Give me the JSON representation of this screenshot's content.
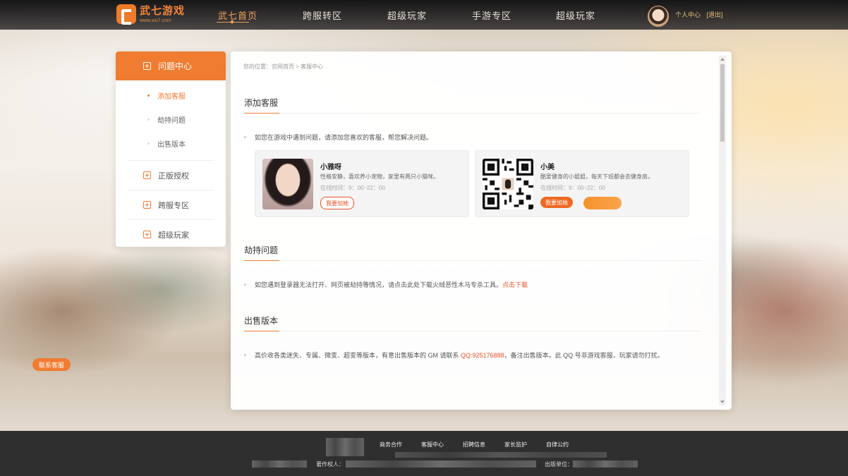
{
  "header": {
    "logo": {
      "name": "武七游戏",
      "url": "www.wu7.com"
    },
    "nav": [
      {
        "label": "武七首页",
        "active": true
      },
      {
        "label": "跨服转区",
        "active": false
      },
      {
        "label": "超级玩家",
        "active": false
      },
      {
        "label": "手游专区",
        "active": false
      },
      {
        "label": "超级玩家",
        "active": false
      }
    ],
    "user": {
      "center": "个人中心",
      "logout": "[退出]"
    }
  },
  "sidebar": {
    "head": "问题中心",
    "subitems": [
      {
        "label": "添加客服",
        "active": true
      },
      {
        "label": "劫持问题",
        "active": false
      },
      {
        "label": "出售版本",
        "active": false
      }
    ],
    "items": [
      {
        "label": "正版授权"
      },
      {
        "label": "跨服专区"
      },
      {
        "label": "超级玩家"
      }
    ]
  },
  "contact_button": "联系客服",
  "main": {
    "breadcrumb": "您的位置：官网首页 > 客服中心",
    "sections": [
      {
        "title": "添加客服",
        "text": "如您在游戏中遇到问题，请添加您喜欢的客服，帮您解决问题。"
      },
      {
        "title": "劫持问题",
        "text": "如您遇到登录器无法打开、网页被劫持等情况，请点击此处下载火绒恶性木马专杀工具。",
        "link": "点击下载"
      },
      {
        "title": "出售版本",
        "text_before": "高价收各类迷失、专属、微变、超变等版本，有意出售版本的 GM 请联系 ",
        "qq": "QQ:925176888",
        "text_after": "，备注出售版本。此 QQ 号非游戏客服，玩家请勿打扰。"
      }
    ],
    "agents": [
      {
        "name": "小雅呀",
        "desc": "性格安静，喜欢养小宠物，家里有两只小猫咪。",
        "time": "在线时间：9：00~22：00",
        "button": "我要加她",
        "image": "portrait"
      },
      {
        "name": "小美",
        "desc": "酷爱健身的小姐姐，每天下班都会去健身房。",
        "time": "在线时间：9：00~22：00",
        "button": "我要加她",
        "image": "qr-code"
      }
    ]
  },
  "footer": {
    "links": [
      "商务合作",
      "客服中心",
      "招聘信息",
      "家长监护",
      "自律公约"
    ],
    "copyright_label": "著作权人：",
    "publisher_label": "出版单位："
  },
  "colors": {
    "accent": "#f07c31",
    "link": "#e8532a",
    "footer": "#2f2f2f"
  }
}
